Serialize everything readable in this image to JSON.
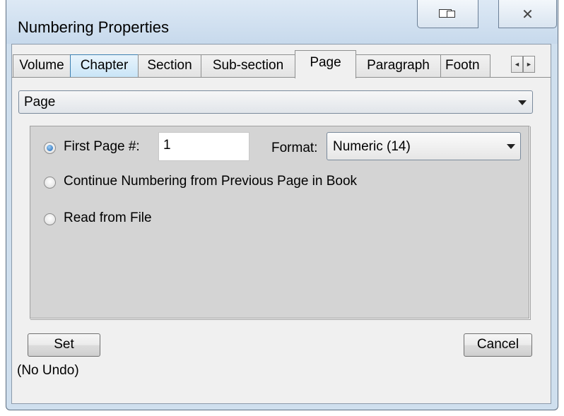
{
  "window": {
    "title": "Numbering Properties",
    "restore_icon": "restore-icon",
    "close_icon": "close-icon"
  },
  "tabs": [
    {
      "label": "Volume",
      "state": "normal"
    },
    {
      "label": "Chapter",
      "state": "hover"
    },
    {
      "label": "Section",
      "state": "normal"
    },
    {
      "label": "Sub-section",
      "state": "normal"
    },
    {
      "label": "Page",
      "state": "active"
    },
    {
      "label": "Paragraph",
      "state": "normal"
    },
    {
      "label": "Footn",
      "state": "normal"
    }
  ],
  "tab_scroll": {
    "left": "◄",
    "right": "►"
  },
  "level_select": {
    "value": "Page"
  },
  "options": {
    "first_page_label": "First Page #:",
    "first_page_value": "1",
    "format_label": "Format:",
    "format_value": "Numeric  (14)",
    "continue_label": "Continue Numbering from Previous Page in Book",
    "read_file_label": "Read from File",
    "selected": "first_page"
  },
  "buttons": {
    "set": "Set",
    "cancel": "Cancel",
    "set_note": "(No Undo)"
  },
  "colors": {
    "accent": "#1a62b5",
    "frame": "#cfdfee"
  }
}
